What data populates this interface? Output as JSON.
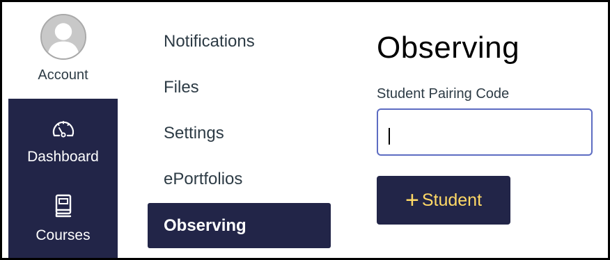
{
  "global_nav": {
    "account": {
      "label": "Account",
      "icon": "user-avatar-icon"
    },
    "dashboard": {
      "label": "Dashboard",
      "icon": "speedometer-icon"
    },
    "courses": {
      "label": "Courses",
      "icon": "book-icon"
    }
  },
  "sub_nav": {
    "items": [
      {
        "label": "Notifications"
      },
      {
        "label": "Files"
      },
      {
        "label": "Settings"
      },
      {
        "label": "ePortfolios"
      },
      {
        "label": "Observing",
        "active": true
      }
    ]
  },
  "content": {
    "title": "Observing",
    "field_label": "Student Pairing Code",
    "input_value": "",
    "add_button_label": "Student"
  },
  "colors": {
    "nav_dark": "#222548",
    "accent_text": "#ffd966",
    "input_border": "#5d6cc2"
  }
}
